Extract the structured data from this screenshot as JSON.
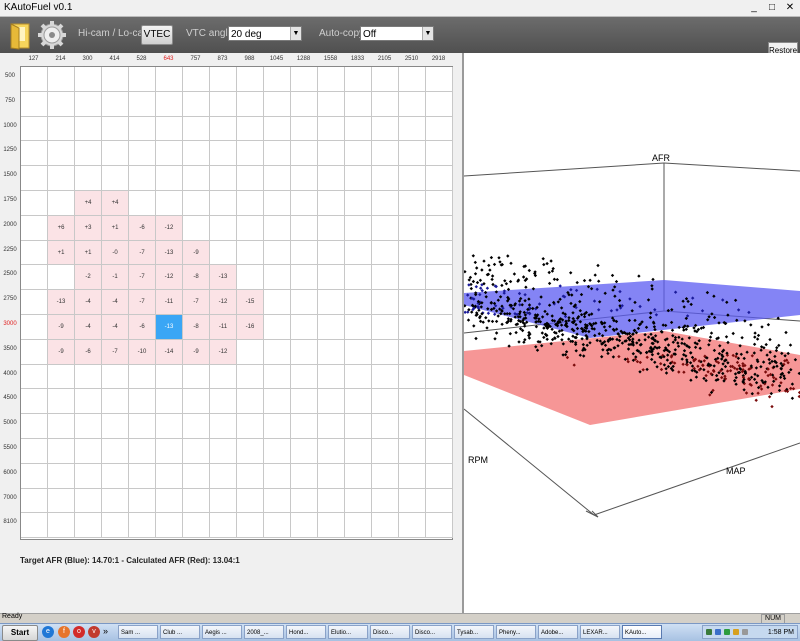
{
  "window": {
    "title": "KAutoFuel v0.1",
    "minimize": "_",
    "maximize": "□",
    "close": "✕"
  },
  "toolbar": {
    "icons": [
      "folder-icon",
      "gear-icon"
    ],
    "hicam_label": "Hi-cam / Lo-cam:",
    "vtec_button": "VTEC",
    "vtc_label": "VTC angle:",
    "vtc_value": "20 deg",
    "autocopy_label": "Auto-copy:",
    "autocopy_value": "Off",
    "restore_label": "Restore"
  },
  "table": {
    "columns": [
      "127",
      "214",
      "300",
      "414",
      "528",
      "643",
      "757",
      "873",
      "988",
      "1045",
      "1288",
      "1558",
      "1833",
      "2105",
      "2510",
      "2918"
    ],
    "highlight_column_index": 5,
    "rows": [
      "500",
      "750",
      "1000",
      "1250",
      "1500",
      "1750",
      "2000",
      "2250",
      "2500",
      "2750",
      "3000",
      "3500",
      "4000",
      "4500",
      "5000",
      "5500",
      "6000",
      "7000",
      "8100"
    ],
    "highlight_row_index": 10,
    "cells": [
      {
        "r": 5,
        "c": 2,
        "v": "+4"
      },
      {
        "r": 5,
        "c": 3,
        "v": "+4"
      },
      {
        "r": 6,
        "c": 1,
        "v": "+6"
      },
      {
        "r": 6,
        "c": 2,
        "v": "+3"
      },
      {
        "r": 6,
        "c": 3,
        "v": "+1"
      },
      {
        "r": 6,
        "c": 4,
        "v": "-6"
      },
      {
        "r": 6,
        "c": 5,
        "v": "-12"
      },
      {
        "r": 7,
        "c": 1,
        "v": "+1"
      },
      {
        "r": 7,
        "c": 2,
        "v": "+1"
      },
      {
        "r": 7,
        "c": 3,
        "v": "-0"
      },
      {
        "r": 7,
        "c": 4,
        "v": "-7"
      },
      {
        "r": 7,
        "c": 5,
        "v": "-13"
      },
      {
        "r": 7,
        "c": 6,
        "v": "-9"
      },
      {
        "r": 8,
        "c": 2,
        "v": "-2"
      },
      {
        "r": 8,
        "c": 3,
        "v": "-1"
      },
      {
        "r": 8,
        "c": 4,
        "v": "-7"
      },
      {
        "r": 8,
        "c": 5,
        "v": "-12"
      },
      {
        "r": 8,
        "c": 6,
        "v": "-8"
      },
      {
        "r": 8,
        "c": 7,
        "v": "-13"
      },
      {
        "r": 9,
        "c": 1,
        "v": "-13"
      },
      {
        "r": 9,
        "c": 2,
        "v": "-4"
      },
      {
        "r": 9,
        "c": 3,
        "v": "-4"
      },
      {
        "r": 9,
        "c": 4,
        "v": "-7"
      },
      {
        "r": 9,
        "c": 5,
        "v": "-11"
      },
      {
        "r": 9,
        "c": 6,
        "v": "-7"
      },
      {
        "r": 9,
        "c": 7,
        "v": "-12"
      },
      {
        "r": 9,
        "c": 8,
        "v": "-15"
      },
      {
        "r": 10,
        "c": 1,
        "v": "-9"
      },
      {
        "r": 10,
        "c": 2,
        "v": "-4"
      },
      {
        "r": 10,
        "c": 3,
        "v": "-4"
      },
      {
        "r": 10,
        "c": 4,
        "v": "-6"
      },
      {
        "r": 10,
        "c": 5,
        "v": "-13",
        "selected": true
      },
      {
        "r": 10,
        "c": 6,
        "v": "-8"
      },
      {
        "r": 10,
        "c": 7,
        "v": "-11"
      },
      {
        "r": 10,
        "c": 8,
        "v": "-16"
      },
      {
        "r": 11,
        "c": 1,
        "v": "-9"
      },
      {
        "r": 11,
        "c": 2,
        "v": "-6"
      },
      {
        "r": 11,
        "c": 3,
        "v": "-7"
      },
      {
        "r": 11,
        "c": 4,
        "v": "-10"
      },
      {
        "r": 11,
        "c": 5,
        "v": "-14"
      },
      {
        "r": 11,
        "c": 6,
        "v": "-9"
      },
      {
        "r": 11,
        "c": 7,
        "v": "-12"
      }
    ]
  },
  "status_line": "Target AFR (Blue): 14.70:1 - Calculated AFR (Red): 13.04:1",
  "plot3d": {
    "axis_labels": {
      "afr": "AFR",
      "rpm": "RPM",
      "map": "MAP"
    },
    "target_plane_color": "#5b5bf2",
    "calculated_plane_color": "#f26a6a",
    "point_color": "#000000"
  },
  "statusbar": {
    "text": "Ready",
    "num": "NUM"
  },
  "taskbar": {
    "start_label": "Start",
    "quick_launch": [
      "ie-icon",
      "firefox-icon",
      "opera-icon",
      "vivaldi-icon"
    ],
    "more": "»",
    "tasks": [
      "Sam ...",
      "Club ...",
      "Aegis ...",
      "2008_...",
      "Hond...",
      "Elutio...",
      "Disco...",
      "Disco...",
      "Tysab...",
      "Pheny...",
      "Adobe...",
      "LEXAR...",
      "KAuto..."
    ],
    "active_task_index": 12,
    "clock": "1:58 PM"
  }
}
